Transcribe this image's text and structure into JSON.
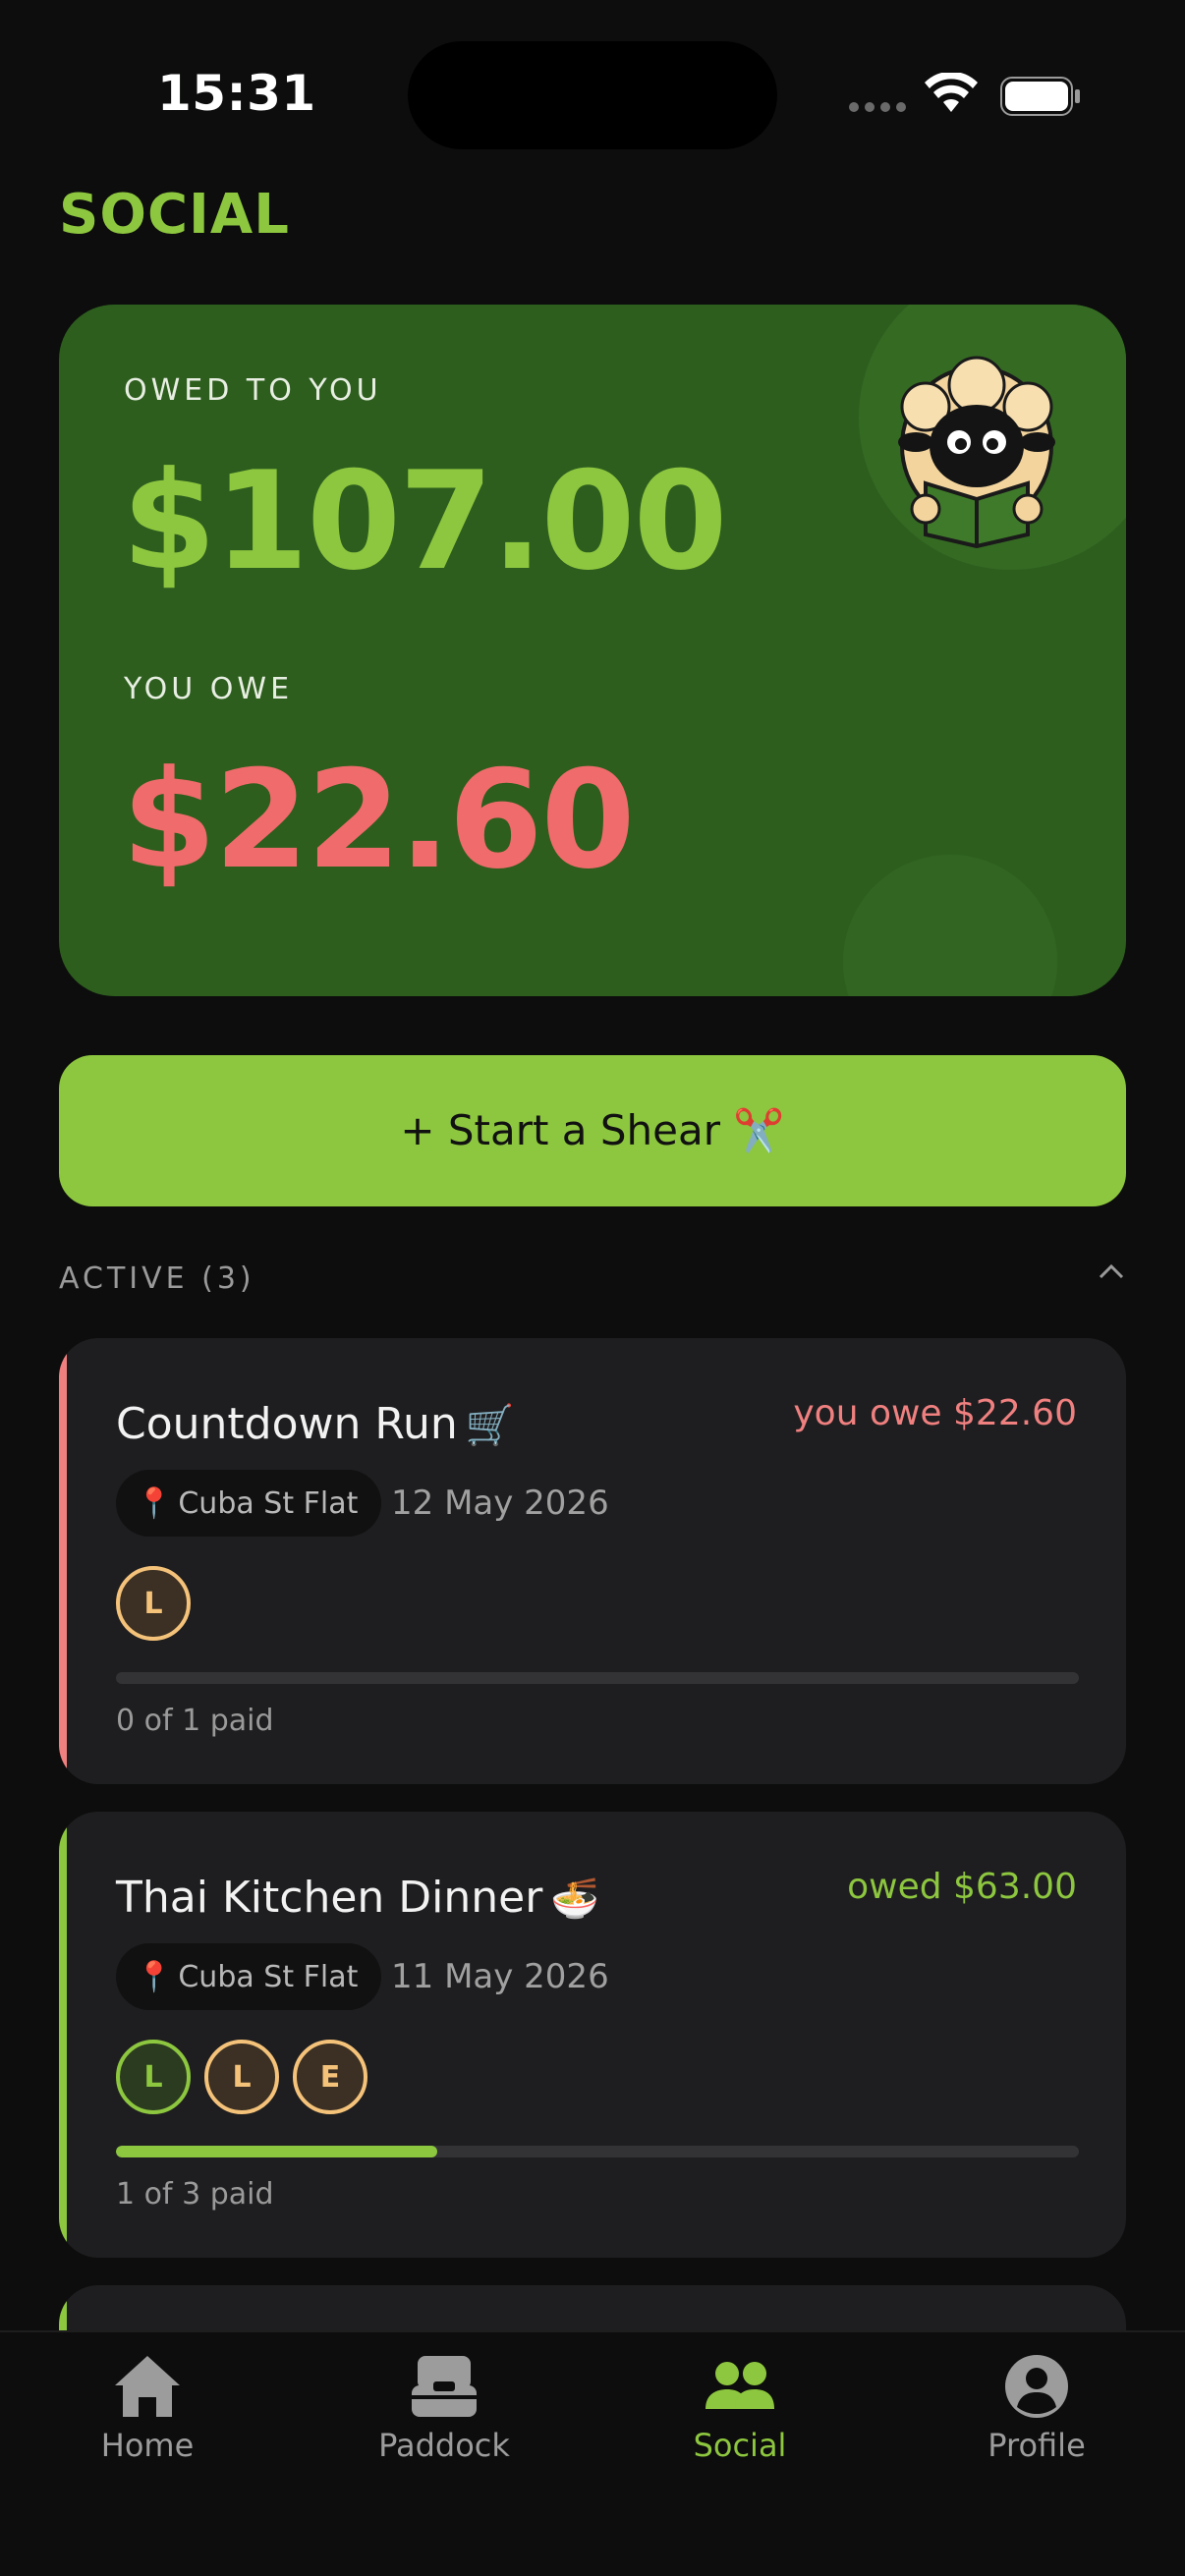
{
  "status_bar": {
    "time": "15:31"
  },
  "page": {
    "title": "SOCIAL"
  },
  "balance": {
    "owed_label": "OWED TO YOU",
    "owed_amount": "$107.00",
    "owe_label": "YOU OWE",
    "owe_amount": "$22.60"
  },
  "cta": {
    "label": "+ Start a Shear ✂️"
  },
  "active_section": {
    "label": "ACTIVE (3)"
  },
  "shears": [
    {
      "title": "Countdown Run",
      "emoji": "🛒",
      "amount_text": "you owe $22.60",
      "amount_color": "#f08080",
      "accent_color": "#f08080",
      "location": "Cuba St Flat",
      "date": "12 May 2026",
      "avatars": [
        {
          "initial": "L",
          "status": "pending"
        }
      ],
      "progress": 0,
      "paid_text": "0 of 1 paid"
    },
    {
      "title": "Thai Kitchen Dinner",
      "emoji": "🍜",
      "amount_text": "owed $63.00",
      "amount_color": "#8dc63f",
      "accent_color": "#8dc63f",
      "location": "Cuba St Flat",
      "date": "11 May 2026",
      "avatars": [
        {
          "initial": "L",
          "status": "paid"
        },
        {
          "initial": "L",
          "status": "pending"
        },
        {
          "initial": "E",
          "status": "pending"
        }
      ],
      "progress": 0.3333,
      "paid_text": "1 of 3 paid"
    }
  ],
  "tabs": [
    {
      "label": "Home",
      "icon": "home-icon",
      "active": false
    },
    {
      "label": "Paddock",
      "icon": "inbox-icon",
      "active": false
    },
    {
      "label": "Social",
      "icon": "people-icon",
      "active": true
    },
    {
      "label": "Profile",
      "icon": "profile-icon",
      "active": false
    }
  ],
  "colors": {
    "accent_green": "#8dc63f",
    "owe_red": "#f06b6b",
    "card_green": "#2d5e1e",
    "background": "#0c0d0c"
  }
}
